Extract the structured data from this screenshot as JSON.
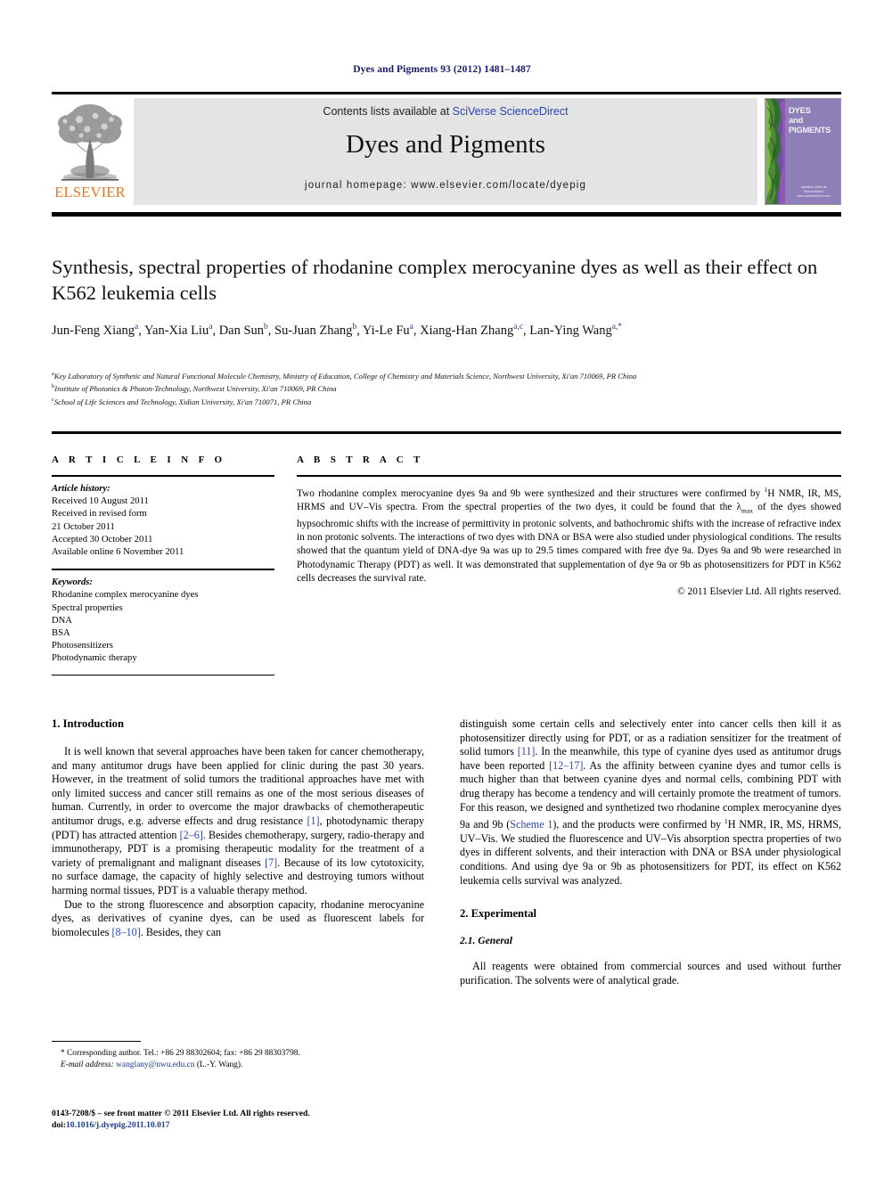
{
  "running_head": "Dyes and Pigments 93 (2012) 1481–1487",
  "masthead": {
    "contents_prefix": "Contents lists available at ",
    "contents_link": "SciVerse ScienceDirect",
    "journal_title": "Dyes and Pigments",
    "homepage": "journal homepage: www.elsevier.com/locate/dyepig",
    "publisher_name": "ELSEVIER",
    "cover_title": "DYES and PIGMENTS",
    "cover_footer_top": "available online at",
    "cover_footer_mid": "ScienceDirect",
    "cover_footer_bot": "www.sciencedirect.com",
    "colors": {
      "grey_box": "#e4e4e4",
      "link_blue": "#2b44b5",
      "elsevier_orange": "#E87722",
      "cover_purple": "#8f7fb8"
    }
  },
  "article": {
    "title": "Synthesis, spectral properties of rhodanine complex merocyanine dyes as well as their effect on K562 leukemia cells",
    "authors": [
      {
        "name": "Jun-Feng Xiang",
        "marks": "a"
      },
      {
        "name": "Yan-Xia Liu",
        "marks": "a"
      },
      {
        "name": "Dan Sun",
        "marks": "b"
      },
      {
        "name": "Su-Juan Zhang",
        "marks": "b"
      },
      {
        "name": "Yi-Le Fu",
        "marks": "a"
      },
      {
        "name": "Xiang-Han Zhang",
        "marks": "a,c"
      },
      {
        "name": "Lan-Ying Wang",
        "marks": "a,*"
      }
    ],
    "affiliations": [
      {
        "mark": "a",
        "text": "Key Laboratory of Synthetic and Natural Functional Molecule Chemistry, Ministry of Education, College of Chemistry and Materials Science, Northwest University, Xi'an 710069, PR China"
      },
      {
        "mark": "b",
        "text": "Institute of Photonics & Photon-Technology, Northwest University, Xi'an 710069, PR China"
      },
      {
        "mark": "c",
        "text": "School of Life Sciences and Technology, Xidian University, Xi'an 710071, PR China"
      }
    ]
  },
  "article_info": {
    "heading": "A R T I C L E   I N F O",
    "history_label": "Article history:",
    "history": [
      "Received 10 August 2011",
      "Received in revised form",
      "21 October 2011",
      "Accepted 30 October 2011",
      "Available online 6 November 2011"
    ],
    "keywords_label": "Keywords:",
    "keywords": [
      "Rhodanine complex merocyanine dyes",
      "Spectral properties",
      "DNA",
      "BSA",
      "Photosensitizers",
      "Photodynamic therapy"
    ]
  },
  "abstract": {
    "heading": "A B S T R A C T",
    "body_part1": "Two rhodanine complex merocyanine dyes 9a and 9b were synthesized and their structures were confirmed by ",
    "body_sup1": "1",
    "body_part2": "H NMR, IR, MS, HRMS and UV–Vis spectra. From the spectral properties of the two dyes, it could be found that the λ",
    "body_sub1": "max",
    "body_part3": " of the dyes showed hypsochromic shifts with the increase of permittivity in protonic solvents, and bathochromic shifts with the increase of refractive index in non protonic solvents. The interactions of two dyes with DNA or BSA were also studied under physiological conditions. The results showed that the quantum yield of DNA-dye 9a was up to 29.5 times compared with free dye 9a. Dyes 9a and 9b were researched in Photodynamic Therapy (PDT) as well. It was demonstrated that supplementation of dye 9a or 9b as photosensitizers for PDT in K562 cells decreases the survival rate.",
    "copyright": "© 2011 Elsevier Ltd. All rights reserved."
  },
  "sections": {
    "introduction_heading": "1. Introduction",
    "intro_p1_a": "It is well known that several approaches have been taken for cancer chemotherapy, and many antitumor drugs have been applied for clinic during the past 30 years. However, in the treatment of solid tumors the traditional approaches have met with only limited success and cancer still remains as one of the most serious diseases of human. Currently, in order to overcome the major drawbacks of chemotherapeutic antitumor drugs, e.g. adverse effects and drug resistance ",
    "intro_ref1": "[1]",
    "intro_p1_b": ", photodynamic therapy (PDT) has attracted attention ",
    "intro_ref2": "[2–6]",
    "intro_p1_c": ". Besides chemotherapy, surgery, radio-therapy and immunotherapy, PDT is a promising therapeutic modality for the treatment of a variety of premalignant and malignant diseases ",
    "intro_ref3": "[7]",
    "intro_p1_d": ". Because of its low cytotoxicity, no surface damage, the capacity of highly selective and destroying tumors without harming normal tissues, PDT is a valuable therapy method.",
    "intro_p2_a": "Due to the strong fluorescence and absorption capacity, rhodanine merocyanine dyes, as derivatives of cyanine dyes, can be used as fluorescent labels for biomolecules ",
    "intro_ref4": "[8–10]",
    "intro_p2_b": ". Besides, they can",
    "intro_p3_a": "distinguish some certain cells and selectively enter into cancer cells then kill it as photosensitizer directly using for PDT, or as a radiation sensitizer for the treatment of solid tumors ",
    "intro_ref5": "[11]",
    "intro_p3_b": ". In the meanwhile, this type of cyanine dyes used as antitumor drugs have been reported ",
    "intro_ref6": "[12–17]",
    "intro_p3_c": ". As the affinity between cyanine dyes and tumor cells is much higher than that between cyanine dyes and normal cells, combining PDT with drug therapy has become a tendency and will certainly promote the treatment of tumors. For this reason, we designed and synthetized two rhodanine complex merocyanine dyes 9a and 9b (",
    "intro_ref7": "Scheme 1",
    "intro_p3_d": "), and the products were confirmed by ",
    "intro_sup": "1",
    "intro_p3_e": "H NMR, IR, MS, HRMS, UV–Vis. We studied the fluorescence and UV–Vis absorption spectra properties of two dyes in different solvents, and their interaction with DNA or BSA under physiological conditions. And using dye 9a or 9b as photosensitizers for PDT, its effect on K562 leukemia cells survival was analyzed.",
    "experimental_heading": "2. Experimental",
    "general_heading": "2.1. General",
    "general_p1": "All reagents were obtained from commercial sources and used without further purification. The solvents were of analytical grade."
  },
  "footnote": {
    "star": "*",
    "corr_a": " Corresponding author. Tel.: +86 29 88302604; fax: +86 29 88303798.",
    "email_label": "E-mail address:",
    "email": "wanglany@nwu.edu.cn",
    "email_owner": " (L.-Y. Wang)."
  },
  "front_matter": {
    "line1": "0143-7208/$ – see front matter © 2011 Elsevier Ltd. All rights reserved.",
    "doi_label": "doi:",
    "doi_value": "10.1016/j.dyepig.2011.10.017"
  }
}
